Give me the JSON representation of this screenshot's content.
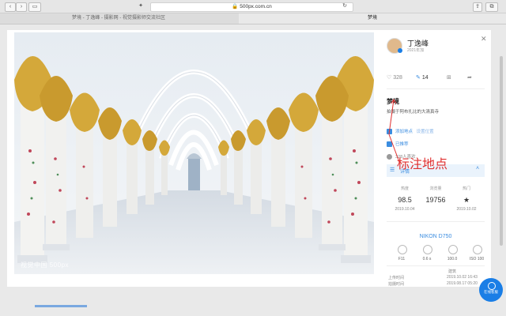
{
  "browser": {
    "url": "500px.com.cn",
    "tabs": [
      "梦境 - 丁逸峰 - 摄影网 - 视觉摄影师交流社区",
      "梦境"
    ]
  },
  "photo": {
    "watermark": "视觉中国 500px"
  },
  "author": {
    "name": "丁逸峰",
    "sub": "2021年加"
  },
  "stats": {
    "likes": "328",
    "shares": "14"
  },
  "work": {
    "title": "梦境",
    "description": "拍摄于阿布扎比的大清真寺",
    "rows": [
      {
        "text": "添加地点",
        "extra": "设置位置"
      },
      {
        "text": "已推荐"
      },
      {
        "text": "328人喜欢"
      }
    ]
  },
  "annotation": "标注地点",
  "details": {
    "label": "详情",
    "items": [
      {
        "label": "热度",
        "value": "98.5",
        "date": "2019.10.04"
      },
      {
        "label": "浏览量",
        "value": "19756",
        "date": ""
      },
      {
        "label": "热门",
        "value": "★",
        "date": "2019.10.02"
      }
    ],
    "camera": "NIKON D750",
    "specs": [
      "F11",
      "0.6 s",
      "100.0",
      "ISO 100"
    ],
    "meta": [
      {
        "label": "",
        "value": "建筑"
      },
      {
        "label": "上传时间",
        "value": "2019.10.02 16:43"
      },
      {
        "label": "拍摄时间",
        "value": "2019.08.17 05:20"
      }
    ]
  },
  "fab": {
    "label": "在线客服"
  }
}
